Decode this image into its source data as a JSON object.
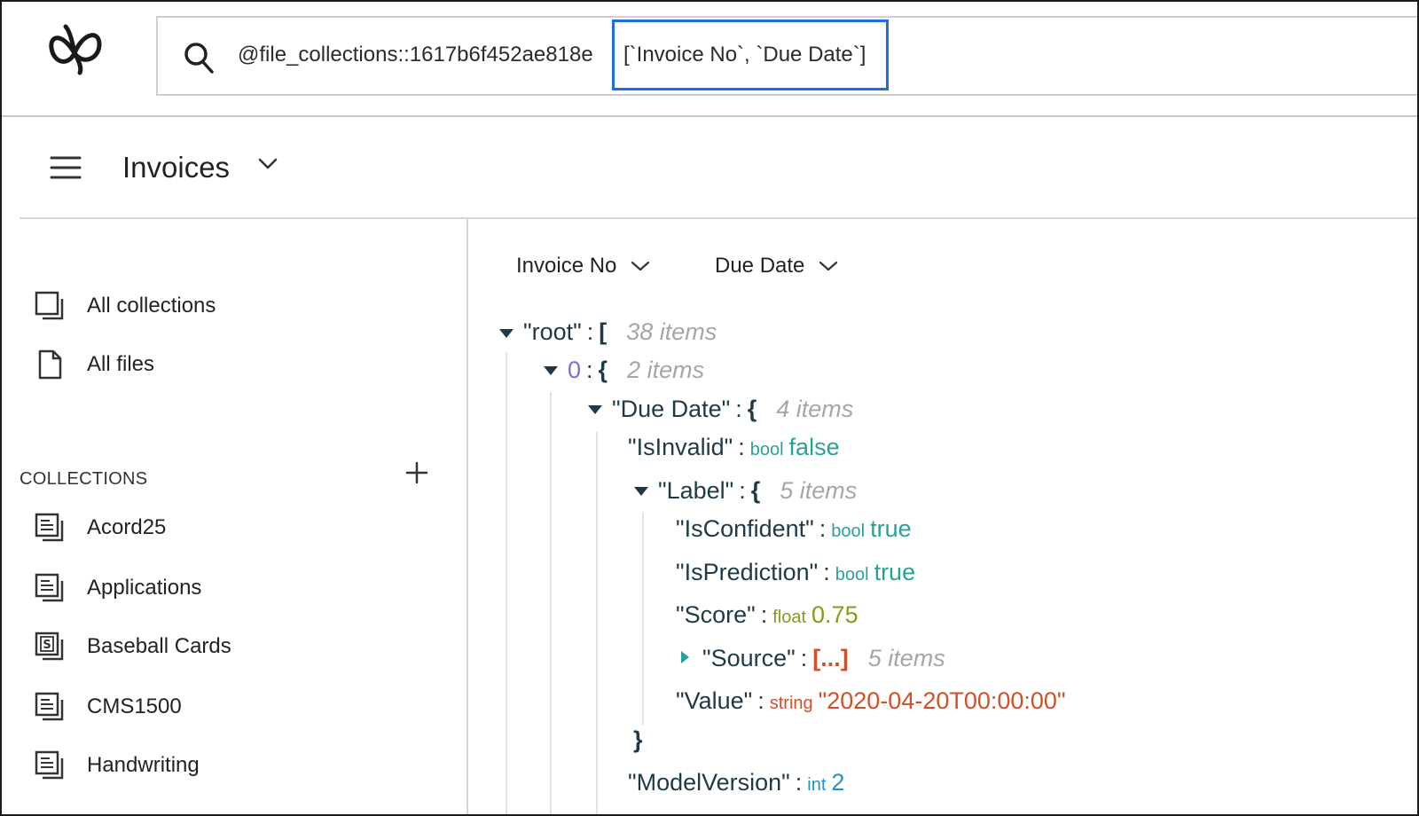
{
  "search": {
    "prefix": "@file_collections::1617b6f452ae818e",
    "query": "[`Invoice No`, `Due Date`]"
  },
  "header": {
    "title": "Invoices"
  },
  "sidebar": {
    "top_items": [
      {
        "label": "All collections",
        "icon": "collections-icon"
      },
      {
        "label": "All files",
        "icon": "file-icon"
      }
    ],
    "section_label": "COLLECTIONS",
    "collections": [
      {
        "label": "Acord25",
        "icon": "document-icon"
      },
      {
        "label": "Applications",
        "icon": "document-icon"
      },
      {
        "label": "Baseball Cards",
        "icon": "sample-document-icon"
      },
      {
        "label": "CMS1500",
        "icon": "document-icon"
      },
      {
        "label": "Handwriting",
        "icon": "document-icon"
      }
    ]
  },
  "main": {
    "columns": [
      {
        "label": "Invoice No"
      },
      {
        "label": "Due Date"
      }
    ],
    "tree": {
      "root_key": "\"root\"",
      "root_count": "38 items",
      "item0_index": "0",
      "item0_count": "2 items",
      "due_date_key": "\"Due Date\"",
      "due_date_count": "4 items",
      "isinvalid_key": "\"IsInvalid\"",
      "isinvalid_type": "bool",
      "isinvalid_value": "false",
      "label_key": "\"Label\"",
      "label_count": "5 items",
      "isconfident_key": "\"IsConfident\"",
      "isconfident_type": "bool",
      "isconfident_value": "true",
      "isprediction_key": "\"IsPrediction\"",
      "isprediction_type": "bool",
      "isprediction_value": "true",
      "score_key": "\"Score\"",
      "score_type": "float",
      "score_value": "0.75",
      "source_key": "\"Source\"",
      "source_collapsed": "[...]",
      "source_count": "5 items",
      "value_key": "\"Value\"",
      "value_type": "string",
      "value_value": "\"2020-04-20T00:00:00\"",
      "modelversion_key": "\"ModelVersion\"",
      "modelversion_type": "int",
      "modelversion_value": "2"
    }
  },
  "colors": {
    "accent_focus": "#1e6fd9",
    "bool": "#2aa198",
    "float": "#8a9a1a",
    "string": "#d1502a",
    "int": "#2a8fcf",
    "index": "#7b6fd6"
  }
}
